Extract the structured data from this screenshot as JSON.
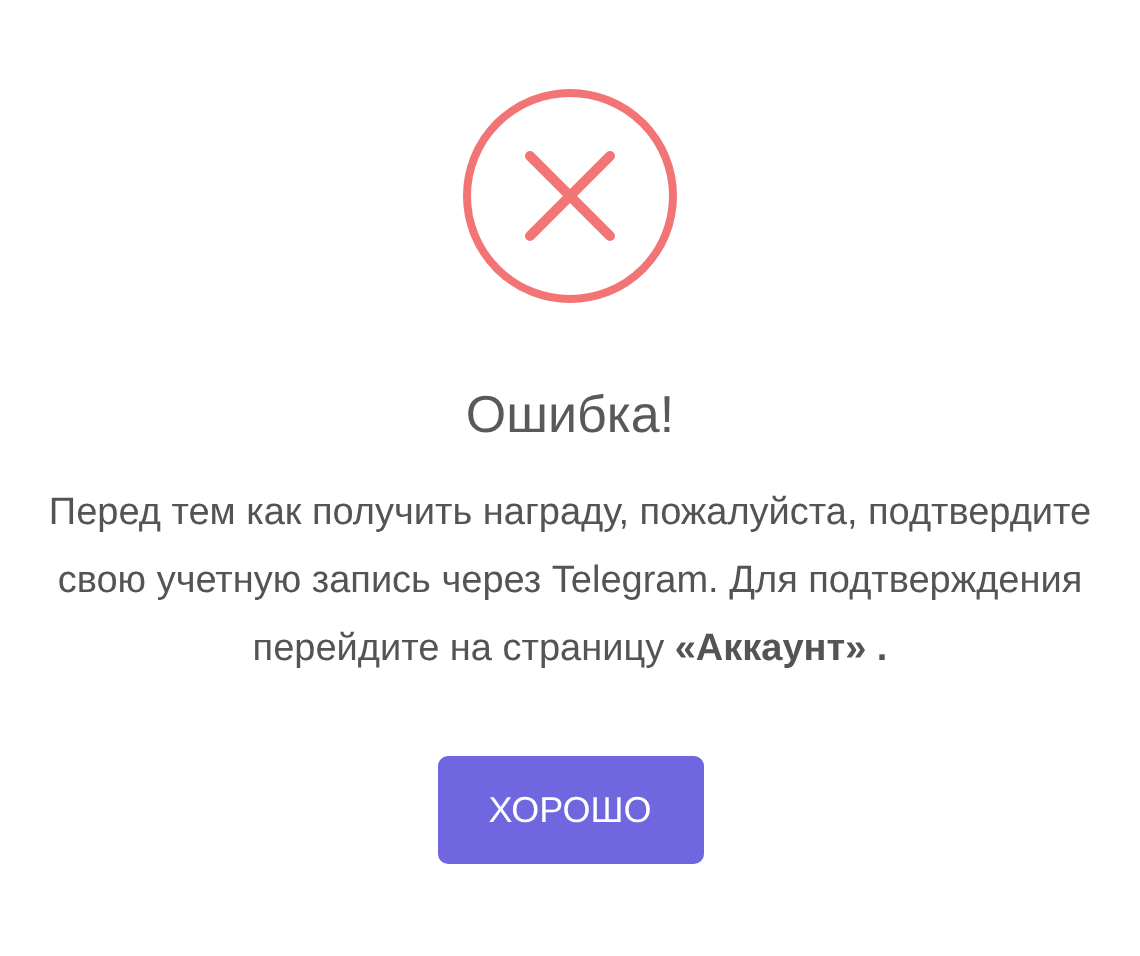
{
  "dialog": {
    "icon": {
      "kind": "error"
    },
    "title": "Ошибка!",
    "message": "Перед тем как получить награду, пожалуйста, подтвердите свою учетную запись через Telegram. Для подтверждения перейдите на страницу **«Аккаунт» .**",
    "buttons": [
      "ХОРОШО"
    ]
  }
}
